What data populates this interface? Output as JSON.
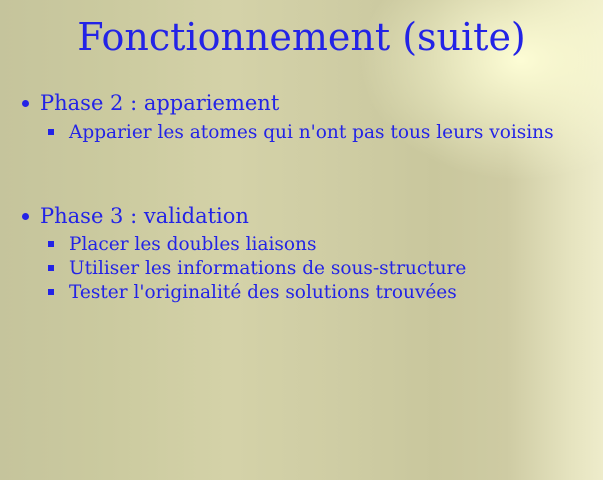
{
  "slide": {
    "title": "Fonctionnement (suite)",
    "sections": [
      {
        "heading": "Phase 2 : appariement",
        "items": [
          "Apparier les atomes qui n'ont pas tous leurs voisins"
        ]
      },
      {
        "heading": "Phase 3 : validation",
        "items": [
          "Placer les doubles liaisons",
          "Utiliser les informations de sous-structure",
          "Tester l'originalité des solutions trouvées"
        ]
      }
    ],
    "colors": {
      "text": "#2323e6"
    }
  }
}
